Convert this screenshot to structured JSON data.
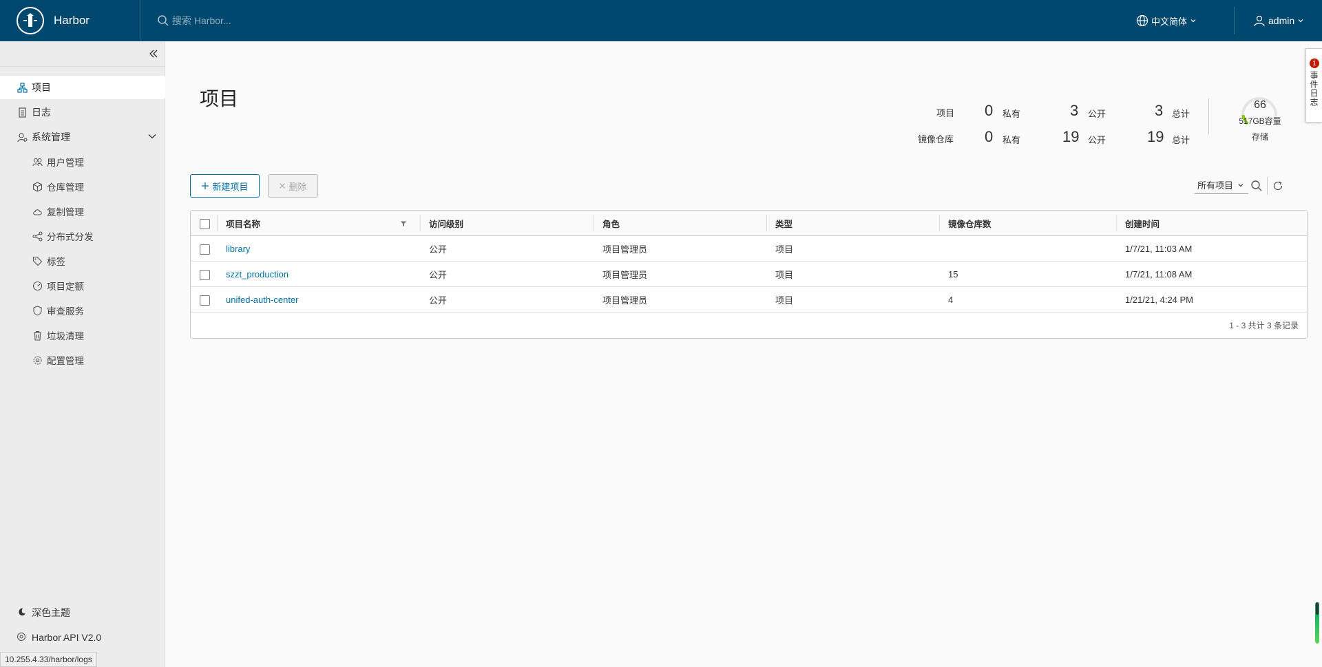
{
  "header": {
    "brand": "Harbor",
    "search_placeholder": "搜索 Harbor...",
    "language": "中文简体",
    "user": "admin"
  },
  "sidebar": {
    "items": [
      {
        "label": "项目",
        "icon": "project-icon"
      },
      {
        "label": "日志",
        "icon": "log-icon"
      },
      {
        "label": "系统管理",
        "icon": "admin-icon"
      }
    ],
    "sub_items": [
      {
        "label": "用户管理",
        "icon": "users-icon"
      },
      {
        "label": "仓库管理",
        "icon": "box-icon"
      },
      {
        "label": "复制管理",
        "icon": "cloud-icon"
      },
      {
        "label": "分布式分发",
        "icon": "share-icon"
      },
      {
        "label": "标签",
        "icon": "tag-icon"
      },
      {
        "label": "项目定额",
        "icon": "dashboard-icon"
      },
      {
        "label": "审查服务",
        "icon": "shield-icon"
      },
      {
        "label": "垃圾清理",
        "icon": "trash-icon"
      },
      {
        "label": "配置管理",
        "icon": "gear-icon"
      }
    ],
    "dark_theme": "深色主题",
    "api": "Harbor API V2.0",
    "status_url": "10.255.4.33/harbor/logs"
  },
  "page": {
    "title": "项目"
  },
  "stats": {
    "projects_label": "项目",
    "repos_label": "镜像仓库",
    "private_label": "私有",
    "public_label": "公开",
    "total_label": "总计",
    "projects": {
      "private": "0",
      "public": "3",
      "total": "3"
    },
    "repos": {
      "private": "0",
      "public": "19",
      "total": "19"
    },
    "storage": {
      "used": "66",
      "capacity": "517GB容量",
      "label": "存储",
      "fraction": 0.13
    }
  },
  "toolbar": {
    "new_label": "新建项目",
    "delete_label": "删除",
    "filter_value": "所有项目"
  },
  "table": {
    "columns": [
      "项目名称",
      "访问级别",
      "角色",
      "类型",
      "镜像仓库数",
      "创建时间"
    ],
    "rows": [
      {
        "name": "library",
        "access": "公开",
        "role": "项目管理员",
        "type": "项目",
        "repos": "",
        "created": "1/7/21, 11:03 AM"
      },
      {
        "name": "szzt_production",
        "access": "公开",
        "role": "项目管理员",
        "type": "项目",
        "repos": "15",
        "created": "1/7/21, 11:08 AM"
      },
      {
        "name": "unifed-auth-center",
        "access": "公开",
        "role": "项目管理员",
        "type": "项目",
        "repos": "4",
        "created": "1/21/21, 4:24 PM"
      }
    ],
    "footer": "1 - 3 共计 3 条记录"
  },
  "float_tab": {
    "badge": "1",
    "text": "事件日志"
  },
  "colors": {
    "header_bg": "#00486e",
    "link": "#0072a3",
    "badge": "#c21d00"
  }
}
